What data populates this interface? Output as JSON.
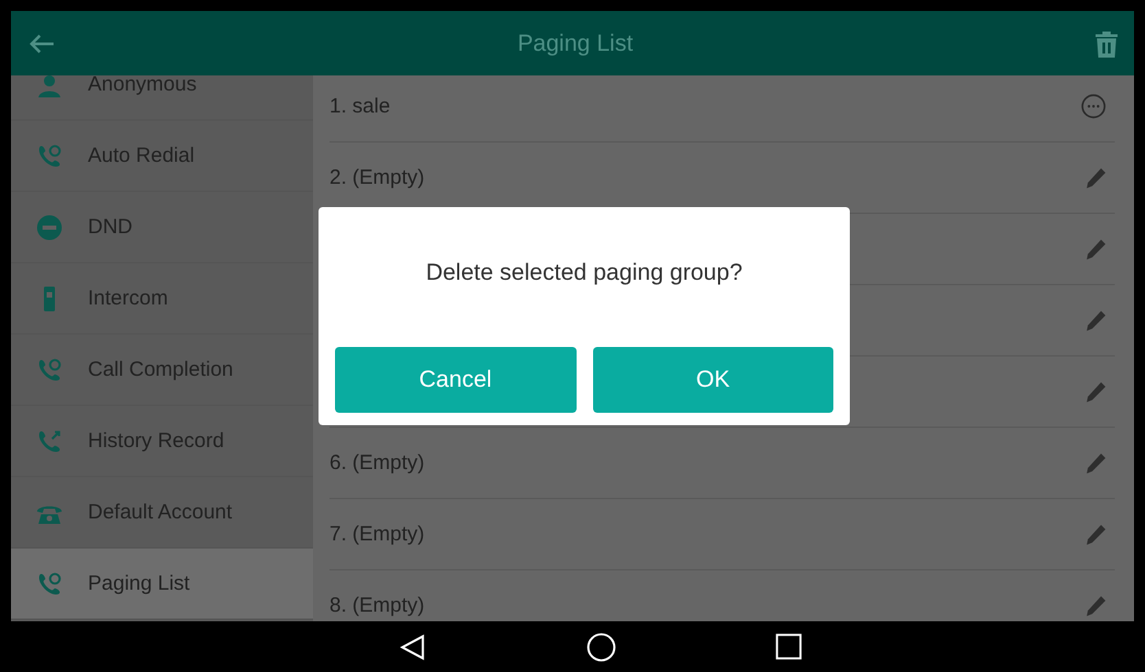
{
  "header": {
    "title": "Paging List"
  },
  "sidebar": {
    "items": [
      {
        "label": "Anonymous",
        "selected": false
      },
      {
        "label": "Auto Redial",
        "selected": false
      },
      {
        "label": "DND",
        "selected": false
      },
      {
        "label": "Intercom",
        "selected": false
      },
      {
        "label": "Call Completion",
        "selected": false
      },
      {
        "label": "History Record",
        "selected": false
      },
      {
        "label": "Default Account",
        "selected": false
      },
      {
        "label": "Paging List",
        "selected": true
      }
    ]
  },
  "list": {
    "rows": [
      {
        "label": "1. sale",
        "kind": "more"
      },
      {
        "label": "2. (Empty)",
        "kind": "edit"
      },
      {
        "kind": "edit"
      },
      {
        "kind": "edit"
      },
      {
        "kind": "edit"
      },
      {
        "label": "6. (Empty)",
        "kind": "edit"
      },
      {
        "label": "7. (Empty)",
        "kind": "edit"
      },
      {
        "label": "8. (Empty)",
        "kind": "edit"
      }
    ]
  },
  "dialog": {
    "message": "Delete selected paging group?",
    "buttons": [
      "Cancel",
      "OK"
    ]
  }
}
